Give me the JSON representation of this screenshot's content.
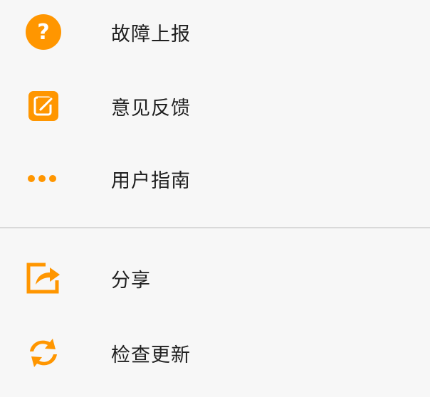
{
  "accent_color": "#FF9600",
  "menu": {
    "items": [
      {
        "label": "故障上报",
        "icon": "question-circle-icon"
      },
      {
        "label": "意见反馈",
        "icon": "edit-note-icon"
      },
      {
        "label": "用户指南",
        "icon": "more-dots-icon"
      },
      {
        "label": "分享",
        "icon": "share-export-icon"
      },
      {
        "label": "检查更新",
        "icon": "refresh-icon"
      }
    ]
  }
}
